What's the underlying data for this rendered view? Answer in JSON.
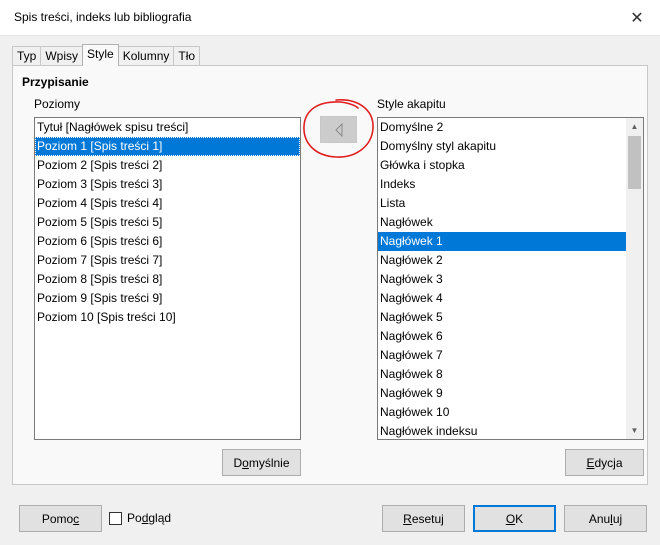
{
  "window": {
    "title": "Spis treści, indeks lub bibliografia"
  },
  "tabs": [
    {
      "label": "Typ"
    },
    {
      "label": "Wpisy"
    },
    {
      "label": "Style"
    },
    {
      "label": "Kolumny"
    },
    {
      "label": "Tło"
    }
  ],
  "active_tab": "Style",
  "section": {
    "title": "Przypisanie"
  },
  "levels": {
    "label": "Poziomy",
    "items": [
      "Tytuł [Nagłówek spisu treści]",
      "Poziom 1 [Spis treści 1]",
      "Poziom 2 [Spis treści 2]",
      "Poziom 3 [Spis treści 3]",
      "Poziom 4 [Spis treści 4]",
      "Poziom 5 [Spis treści 5]",
      "Poziom 6 [Spis treści 6]",
      "Poziom 7 [Spis treści 7]",
      "Poziom 8 [Spis treści 8]",
      "Poziom 9 [Spis treści 9]",
      "Poziom 10 [Spis treści 10]"
    ],
    "selected": "Poziom 1 [Spis treści 1]"
  },
  "styles": {
    "label": "Style akapitu",
    "items": [
      "Domyślne 2",
      "Domyślny styl akapitu",
      "Główka i stopka",
      "Indeks",
      "Lista",
      "Nagłówek",
      "Nagłówek 1",
      "Nagłówek 2",
      "Nagłówek 3",
      "Nagłówek 4",
      "Nagłówek 5",
      "Nagłówek 6",
      "Nagłówek 7",
      "Nagłówek 8",
      "Nagłówek 9",
      "Nagłówek 10",
      "Nagłówek indeksu"
    ],
    "selected": "Nagłówek 1"
  },
  "buttons": {
    "assign_icon": "triangle-left-icon",
    "default_pre": "D",
    "default_u": "o",
    "default_post": "myślnie",
    "edit_pre": "",
    "edit_u": "E",
    "edit_post": "dycja",
    "help_pre": "Pomo",
    "help_u": "c",
    "help_post": "",
    "preview_pre": "Po",
    "preview_u": "d",
    "preview_post": "gląd",
    "reset_pre": "",
    "reset_u": "R",
    "reset_post": "esetuj",
    "ok_pre": "",
    "ok_u": "O",
    "ok_post": "K",
    "cancel_pre": "Anu",
    "cancel_u": "l",
    "cancel_post": "uj"
  },
  "colors": {
    "selection": "#0078d7",
    "annotation": "#e02020"
  }
}
